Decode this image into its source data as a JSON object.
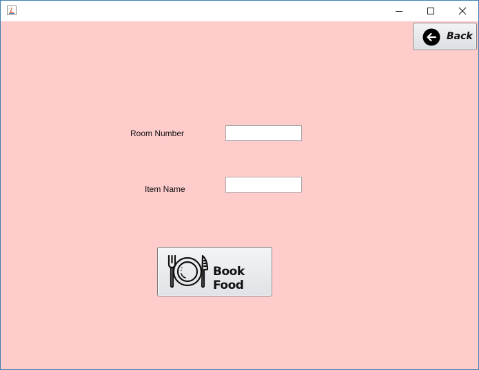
{
  "window": {
    "title": "",
    "controls": {
      "minimize_icon": "minimize-icon",
      "maximize_icon": "maximize-icon",
      "close_icon": "close-icon"
    }
  },
  "colors": {
    "background": "#ffcccc",
    "titlebar": "#ffffff",
    "window_border": "#3c7fb1"
  },
  "toolbar": {
    "back_label": "Back",
    "back_icon": "arrow-left-circle-icon"
  },
  "form": {
    "room_number_label": "Room Number",
    "room_number_value": "",
    "item_name_label": "Item Name",
    "item_name_value": ""
  },
  "actions": {
    "book_food_label": "Book Food",
    "book_food_icon": "plate-fork-knife-icon"
  }
}
